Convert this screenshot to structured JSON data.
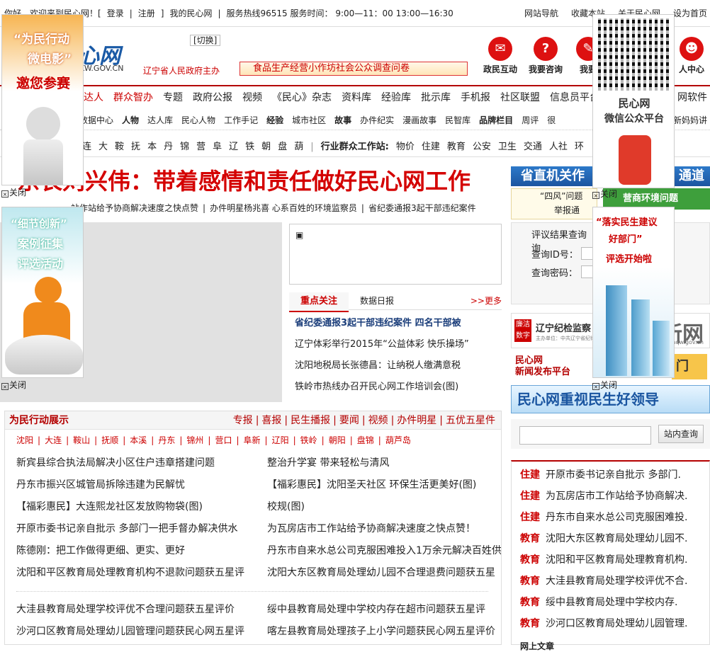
{
  "topbar": {
    "welcome": "你好，欢迎来到民心网！[",
    "login": "登录",
    "register": "注册",
    "bracket": "]",
    "my": "我的民心网",
    "hotline": "服务热线96515 服务时间：  9:00—11：00 13:00—16:30",
    "right": [
      "网站导航",
      "收藏本站",
      "关于民心网",
      "设为首页"
    ]
  },
  "header": {
    "logo": "心网",
    "url": "KW.GOV.CN",
    "switch": "[切换]",
    "gov": "辽宁省人民政府主办",
    "banner": "食品生产经营小作坊社会公众调查问卷",
    "icons": [
      {
        "label": "政民互动",
        "icon": "chat-icon"
      },
      {
        "label": "我要咨询",
        "icon": "question-icon"
      },
      {
        "label": "我要",
        "icon": "mail-icon"
      },
      {
        "label": "人中心",
        "icon": "user-icon"
      }
    ]
  },
  "nav1": [
    "达人",
    "群众智办",
    "专题",
    "政府公报",
    "视频",
    "《民心》杂志",
    "资料库",
    "经验库",
    "批示库",
    "手机报",
    "社区联盟",
    "信息员平台",
    "网",
    "网软件"
  ],
  "nav2": [
    "数据中心",
    "人物",
    "达人库",
    "民心人物",
    "工作手记",
    "经验",
    "城市社区",
    "故事",
    "办件纪实",
    "漫画故事",
    "民智库",
    "品牌栏目",
    "周评",
    "很",
    "新妈妈讲"
  ],
  "nav3": {
    "cities": [
      "连",
      "大",
      "鞍",
      "抚",
      "本",
      "丹",
      "锦",
      "营",
      "阜",
      "辽",
      "铁",
      "朝",
      "盘",
      "葫"
    ],
    "label": "行业群众工作站:",
    "items": [
      "物价",
      "住建",
      "教育",
      "公安",
      "卫生",
      "交通",
      "人社",
      "环"
    ]
  },
  "headline": "东长刘兴伟：带着感情和责任做好民心网工作",
  "subheadlines": [
    "站作站给予协商解决速度之快点赞",
    "|",
    "办件明星杨兆喜  心系百姓的环境监察员",
    "|",
    "省纪委通报3起干部违纪案件"
  ],
  "focus": {
    "tab_active": "重点关注",
    "tab_other": "数据日报",
    "more": ">>更多",
    "items": [
      "省纪委通报3起干部违纪案件  四名干部被",
      "辽宁体彩举行2015年“公益体彩 快乐操场”",
      "沈阳地税局长张德昌：让纳税人缴满意税",
      "铁岭市热线办召开民心网工作培训会(图)"
    ]
  },
  "action": {
    "title": "为民行动展示",
    "tabs": [
      "专报",
      "|",
      "喜报",
      "|",
      "民生播报",
      "|",
      "要闻",
      "|",
      "视频",
      "|",
      "办件明星",
      "|",
      "五优五星件"
    ],
    "cities": [
      "沈阳",
      "|",
      "大连",
      "|",
      "鞍山",
      "|",
      "抚顺",
      "|",
      "本溪",
      "|",
      "丹东",
      "|",
      "锦州",
      "|",
      "营口",
      "|",
      "阜新",
      "|",
      "辽阳",
      "|",
      "铁岭",
      "|",
      "朝阳",
      "|",
      "盘锦",
      "|",
      "葫芦岛"
    ],
    "left": [
      "新宾县综合执法局解决小区住户违章搭建问题",
      "丹东市振兴区城管局拆除违建为民解忧",
      "【福彩惠民】大连熙龙社区发放购物袋(图)",
      "开原市委书记亲自批示  多部门一把手督办解决供水",
      "陈德刚：把工作做得更细、更实、更好",
      "沈阳和平区教育局处理教育机构不退款问题获五星评"
    ],
    "right": [
      "整治升学宴  带来轻松与清风",
      "【福彩惠民】沈阳圣天社区  环保生活更美好(图)",
      "校规(图)",
      "为瓦房店市工作站给予协商解决速度之快点赞！",
      "丹东市自来水总公司克服困难投入1万余元解决百姓供",
      "沈阳大东区教育局处理幼儿园不合理退费问题获五星"
    ],
    "left2": [
      "大洼县教育局处理学校评优不合理问题获五星评价",
      "沙河口区教育局处理幼儿园管理问题获民心网五星评"
    ],
    "right2": [
      "绥中县教育局处理中学校内存在超市问题获五星评",
      "喀左县教育局处理孩子上小学问题获民心网五星评价"
    ]
  },
  "right": {
    "banner1": "省直机关作",
    "banner1_tail": "通道",
    "box1": "“四风”问题",
    "box1b": "举报通",
    "box2": "营商环境问题",
    "query_tabs": [
      "评议结果查询",
      "查询"
    ],
    "query_id": "查询ID号：",
    "query_pw": "查询密码：",
    "ad1_a": "廉洁数字",
    "ad1_b": "辽宁纪检监察",
    "ad1_c": "主办单位：中共辽宁省纪律检查委员会",
    "ad1_d": "新网",
    "ad1_url": "lnqw.gov.cn",
    "ad2_a": "民心网",
    "ad2_b": "新闻发布平台",
    "ad2_c": "门",
    "ad3": "民心网重视民生好领导",
    "search_btn": "站内查询",
    "list": [
      {
        "cat": "住建",
        "text": "开原市委书记亲自批示  多部门."
      },
      {
        "cat": "住建",
        "text": "为瓦房店市工作站给予协商解决."
      },
      {
        "cat": "住建",
        "text": "丹东市自来水总公司克服困难投."
      },
      {
        "cat": "教育",
        "text": "沈阳大东区教育局处理幼儿园不."
      },
      {
        "cat": "教育",
        "text": "沈阳和平区教育局处理教育机构."
      },
      {
        "cat": "教育",
        "text": "大洼县教育局处理学校评优不合."
      },
      {
        "cat": "教育",
        "text": "绥中县教育局处理中学校内存."
      },
      {
        "cat": "教育",
        "text": "沙河口区教育局处理幼儿园管理."
      }
    ],
    "list_footer": "网上文章"
  },
  "float_ads": {
    "ad_left1": {
      "text1": "“为民行动",
      "text2": "微电影”",
      "text3": "邀您参赛"
    },
    "ad_left2": {
      "text1": "“细节创新”",
      "text2": "案例征集",
      "text3": "评选活动"
    },
    "ad_right1": {
      "text1": "民心网",
      "text2": "微信公众平台"
    },
    "ad_right2": {
      "text1": "“落实民生建议",
      "text2": "好部门”",
      "text3": "评选开始啦"
    },
    "close": "关闭"
  },
  "colors": {
    "brand_red": "#b40000",
    "link_blue": "#1a3d7a",
    "accent_blue": "#1c55a0"
  }
}
